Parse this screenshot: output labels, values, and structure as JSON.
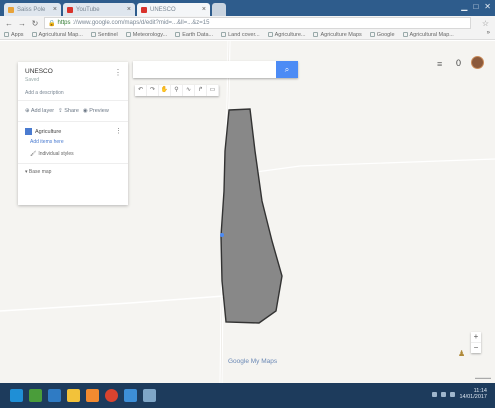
{
  "browser": {
    "tabs": [
      {
        "label": "Saiss Pole",
        "fav": "#e8a33a"
      },
      {
        "label": "YouTube",
        "fav": "#d9322b"
      },
      {
        "label": "UNESCO",
        "fav": "#d9322b"
      }
    ],
    "url_scheme": "https",
    "url_rest": "://www.google.com/maps/d/edit?mid=...&ll=...&z=15",
    "bookmarks": [
      "Apps",
      "Agricultural Map...",
      "Sentinel",
      "Meteorology...",
      "Earth Data...",
      "Land cover...",
      "Agriculture...",
      "Agriculture Maps",
      "Google",
      "Agricultural Map..."
    ]
  },
  "map_panel": {
    "title": "UNESCO",
    "subtitle": "Saved",
    "description": "Add a description",
    "actions": [
      "Add layer",
      "Share",
      "Preview"
    ],
    "layer_name": "Agriculture",
    "add_import": "Add items here",
    "style_label": "Individual styles",
    "base_map": "Base map"
  },
  "search": {
    "placeholder": ""
  },
  "tools": [
    "undo-icon",
    "redo-icon",
    "hand-icon",
    "marker-icon",
    "line-icon",
    "directions-icon",
    "ruler-icon"
  ],
  "top_right": {
    "count": "0"
  },
  "zoom": {
    "in": "+",
    "out": "−"
  },
  "google_logo": "Google My Maps",
  "taskbar": {
    "apps": [
      "#1f8fd6",
      "#4a9d3a",
      "#2f7bc4",
      "#f2c23a",
      "#f28a30",
      "#d9432f",
      "#3d8fd8",
      "#7fa6c7"
    ],
    "time": "11:14",
    "date": "14/01/2017"
  },
  "colors": {
    "polygon_fill": "#888888",
    "polygon_stroke": "#333333",
    "road": "#ffffff",
    "search_button": "#4c8bf5",
    "tabbar": "#2e5c8c",
    "taskbar": "#1d3b5c"
  }
}
